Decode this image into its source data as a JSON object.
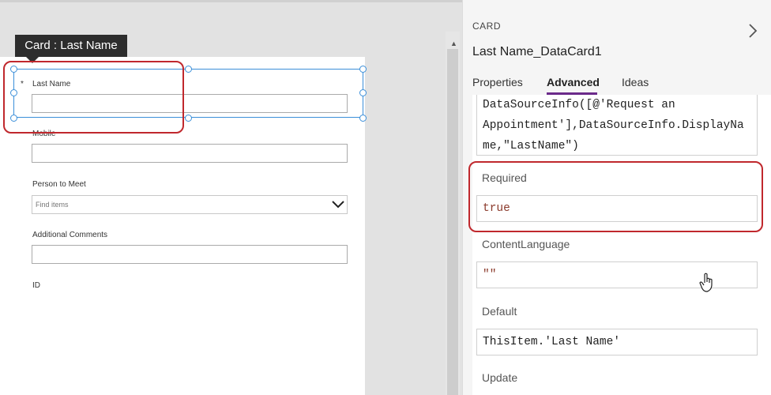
{
  "canvas": {
    "tooltip": "Card : Last Name",
    "fields": [
      {
        "label": "Last Name",
        "required_mark": "*"
      },
      {
        "label": "Mobile"
      },
      {
        "label": "Person to Meet",
        "placeholder": "Find items"
      },
      {
        "label": "Additional Comments"
      },
      {
        "label": "ID"
      }
    ]
  },
  "panel": {
    "header": "CARD",
    "title": "Last Name_DataCard1",
    "tabs": [
      {
        "label": "Properties",
        "active": false
      },
      {
        "label": "Advanced",
        "active": true
      },
      {
        "label": "Ideas",
        "active": false
      }
    ],
    "formula_lines": [
      "DataSourceInfo([@'Request an",
      "Appointment'],DataSourceInfo.DisplayNa",
      "me,\"LastName\")"
    ],
    "properties": [
      {
        "name": "Required",
        "value": "true"
      },
      {
        "name": "ContentLanguage",
        "value": "\"\""
      },
      {
        "name": "Default",
        "value": "ThisItem.'Last Name'"
      },
      {
        "name": "Update",
        "value": ""
      }
    ]
  },
  "colors": {
    "highlight_ring": "#c0282d",
    "selection": "#3b8fd9",
    "tab_accent": "#6b2a8a"
  },
  "icons": [
    "chevron-right-icon",
    "chevron-down-icon",
    "scroll-up-icon",
    "hand-cursor-icon"
  ]
}
